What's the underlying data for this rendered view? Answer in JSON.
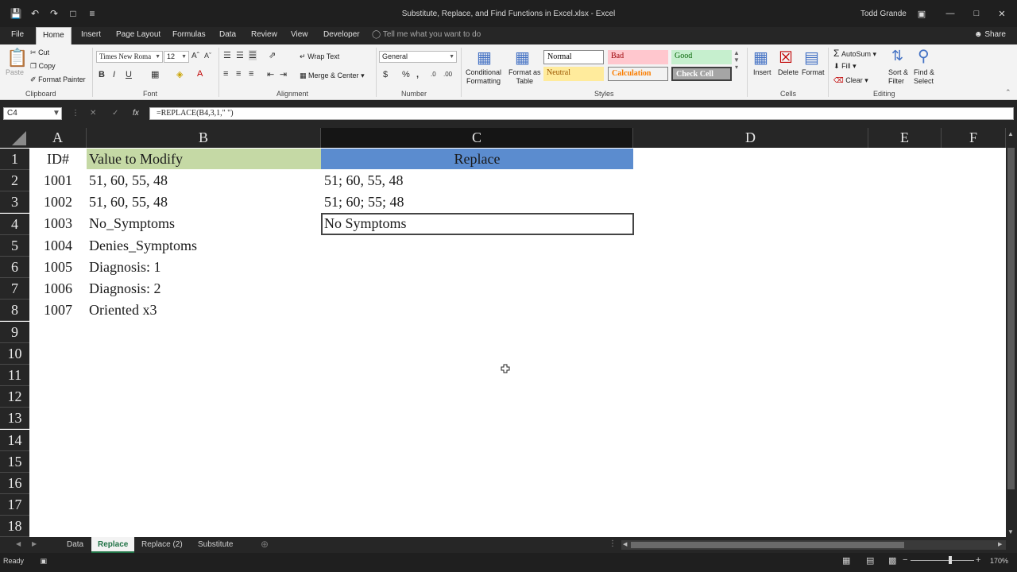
{
  "window": {
    "title": "Substitute, Replace, and Find Functions in Excel.xlsx - Excel",
    "user": "Todd Grande"
  },
  "ribbon_tabs": [
    "File",
    "Home",
    "Insert",
    "Page Layout",
    "Formulas",
    "Data",
    "Review",
    "View",
    "Developer"
  ],
  "active_tab": "Home",
  "tell_me": "Tell me what you want to do",
  "share": "Share",
  "ribbon": {
    "clipboard": {
      "paste": "Paste",
      "cut": "Cut",
      "copy": "Copy",
      "format_painter": "Format Painter",
      "label": "Clipboard"
    },
    "font": {
      "name": "Times New Roma",
      "size": "12",
      "label": "Font"
    },
    "alignment": {
      "wrap_text": "Wrap Text",
      "merge_center": "Merge & Center",
      "label": "Alignment"
    },
    "number": {
      "format": "General",
      "label": "Number"
    },
    "styles": {
      "conditional_formatting": "Conditional\nFormatting",
      "format_as_table": "Format as\nTable",
      "cells": [
        {
          "name": "Normal",
          "bg": "#ffffff",
          "fg": "#000000"
        },
        {
          "name": "Bad",
          "bg": "#ffc7ce",
          "fg": "#9c0006"
        },
        {
          "name": "Good",
          "bg": "#c6efce",
          "fg": "#006100"
        },
        {
          "name": "Neutral",
          "bg": "#ffeb9c",
          "fg": "#9c5700"
        },
        {
          "name": "Calculation",
          "bg": "#f2f2f2",
          "fg": "#fa7d00"
        },
        {
          "name": "Check Cell",
          "bg": "#a5a5a5",
          "fg": "#ffffff"
        }
      ],
      "label": "Styles"
    },
    "cells": {
      "insert": "Insert",
      "delete": "Delete",
      "format": "Format",
      "label": "Cells"
    },
    "editing": {
      "autosum": "AutoSum",
      "fill": "Fill",
      "clear": "Clear",
      "sort_filter": "Sort &\nFilter",
      "find_select": "Find &\nSelect",
      "label": "Editing"
    }
  },
  "formula_bar": {
    "name_box": "C4",
    "formula": "=REPLACE(B4,3,1,\" \")"
  },
  "columns": [
    "A",
    "B",
    "C",
    "D",
    "E",
    "F"
  ],
  "rows": [
    "1",
    "2",
    "3",
    "4",
    "5",
    "6",
    "7",
    "8",
    "9",
    "10",
    "11",
    "12",
    "13",
    "14",
    "15",
    "16",
    "17",
    "18"
  ],
  "header_row": {
    "a": "ID#",
    "b": "Value to Modify",
    "c": "Replace"
  },
  "data_rows": [
    {
      "a": "1001",
      "b": "51, 60, 55, 48",
      "c": "51; 60, 55, 48"
    },
    {
      "a": "1002",
      "b": "51, 60, 55, 48",
      "c": "51; 60; 55; 48"
    },
    {
      "a": "1003",
      "b": "No_Symptoms",
      "c": "No Symptoms"
    },
    {
      "a": "1004",
      "b": "Denies_Symptoms",
      "c": ""
    },
    {
      "a": "1005",
      "b": "Diagnosis: 1",
      "c": ""
    },
    {
      "a": "1006",
      "b": "Diagnosis: 2",
      "c": ""
    },
    {
      "a": "1007",
      "b": "Oriented x3",
      "c": ""
    }
  ],
  "sheet_tabs": [
    "Data",
    "Replace",
    "Replace (2)",
    "Substitute"
  ],
  "active_sheet": "Replace",
  "status": {
    "text": "Ready",
    "zoom": "170%"
  },
  "colors": {
    "header_b": "#c5d9a5",
    "header_c": "#5b8ccf",
    "accent": "#217346"
  }
}
